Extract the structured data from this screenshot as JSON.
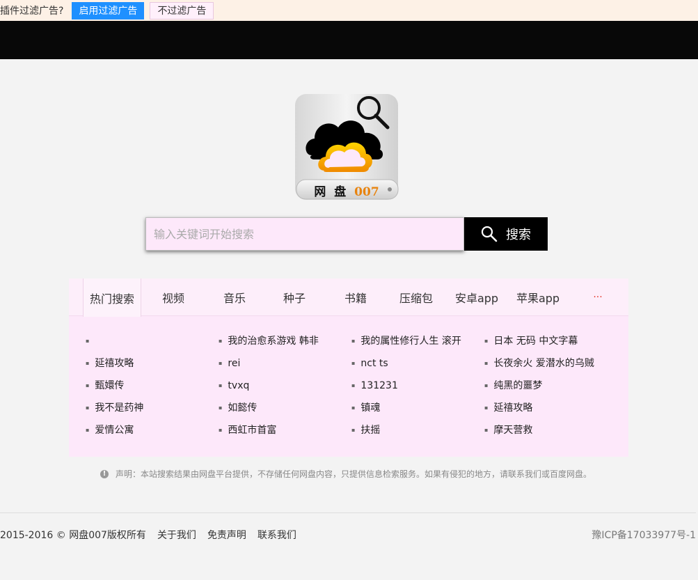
{
  "plugin_bar": {
    "question": "插件过滤广告?",
    "enable_label": "启用过滤广告",
    "disable_label": "不过滤广告"
  },
  "logo": {
    "text": "网 盘",
    "number": "007",
    "cloud_color": "#000000",
    "accent_color": "#f5a623"
  },
  "search": {
    "placeholder": "输入关键词开始搜索",
    "value": "",
    "button_label": "搜索"
  },
  "tabs": [
    {
      "label": "热门搜索",
      "active": true
    },
    {
      "label": "视频"
    },
    {
      "label": "音乐"
    },
    {
      "label": "种子"
    },
    {
      "label": "书籍"
    },
    {
      "label": "压缩包"
    },
    {
      "label": "安卓app"
    },
    {
      "label": "苹果app"
    },
    {
      "label": "···"
    }
  ],
  "hot_columns": [
    [
      "",
      "延禧攻略",
      "甄嬛传",
      "我不是药神",
      "爱情公寓"
    ],
    [
      "我的治愈系游戏 韩非",
      "rei",
      "tvxq",
      "如懿传",
      "西虹市首富"
    ],
    [
      "我的属性修行人生 滚开",
      "nct ts",
      "131231",
      "镇魂",
      "扶摇"
    ],
    [
      "日本 无码 中文字幕",
      "长夜余火 爱潜水的乌贼",
      "纯黑的噩梦",
      "延禧攻略",
      "摩天营救"
    ]
  ],
  "notice": {
    "icon": "info-icon",
    "text": "声明：本站搜索结果由网盘平台提供，不存储任何网盘内容，只提供信息检索服务。如果有侵犯的地方，请联系我们或百度网盘。"
  },
  "footer": {
    "copyright": "2015-2016 © 网盘007版权所有",
    "links": [
      "关于我们",
      "免责声明",
      "联系我们"
    ],
    "icp": "豫ICP备17033977号-1"
  },
  "colors": {
    "plugin_bar_bg": "#fdf1e6",
    "enable_button_bg": "#1e90ff",
    "nav_bg": "#080808",
    "panel_bg": "#fde8fa",
    "search_button_bg": "#000000",
    "more_color": "#e53a2c"
  }
}
